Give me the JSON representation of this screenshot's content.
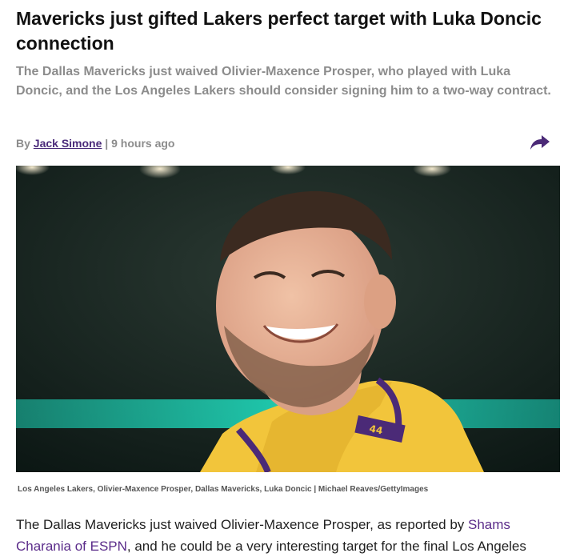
{
  "article": {
    "headline": "Mavericks just gifted Lakers perfect target with Luka Doncic connection",
    "dek": "The Dallas Mavericks just waived Olivier-Maxence Prosper, who played with Luka Doncic, and the Los Angeles Lakers should consider signing him to a two-way contract.",
    "byline": {
      "prefix": "By",
      "author": "Jack Simone",
      "separator": "|",
      "time": "9 hours ago"
    },
    "share_icon": "share-arrow-icon",
    "image": {
      "alt": "Luka Doncic smiling in a Lakers jersey",
      "jersey_number": "44"
    },
    "caption": "Los Angeles Lakers, Olivier-Maxence Prosper, Dallas Mavericks, Luka Doncic | Michael Reaves/GettyImages",
    "body": {
      "text_before_link": "The Dallas Mavericks just waived Olivier-Maxence Prosper, as reported by",
      "link_text": "Shams Charania of ESPN",
      "text_after_link": ", and he could be a very interesting target for the final Los Angeles"
    }
  },
  "colors": {
    "author_link": "#4a2a7a",
    "body_link": "#5b2c8a",
    "muted_text": "#8c8c8c",
    "lakers_gold": "#f2c53b",
    "lakers_purple": "#4b2a77"
  }
}
